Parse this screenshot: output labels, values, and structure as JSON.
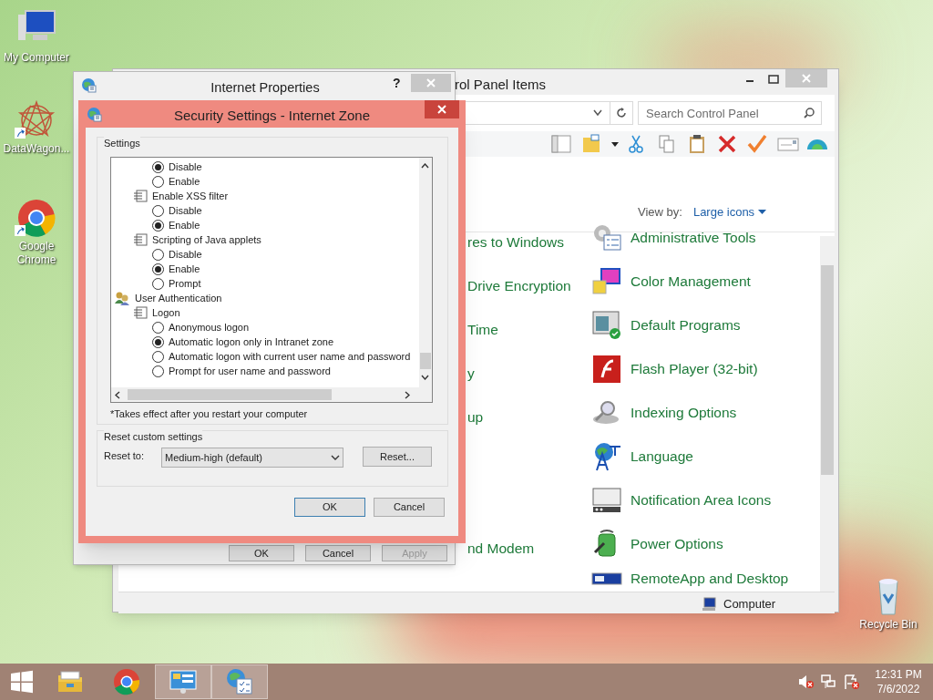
{
  "desktop_icons": [
    {
      "label": "My Computer"
    },
    {
      "label": "DataWagon..."
    },
    {
      "label": "Google Chrome"
    },
    {
      "label": "Recycle Bin"
    }
  ],
  "control_panel": {
    "title": "rol Panel Items",
    "search": {
      "placeholder": "Search Control Panel"
    },
    "view_by": {
      "label": "View by:",
      "value": "Large icons"
    },
    "left_items": [
      "res to Windows",
      "Drive Encryption",
      "Time",
      "y",
      "up",
      "nd Modem"
    ],
    "right_items": [
      "Administrative Tools",
      "Color Management",
      "Default Programs",
      "Flash Player (32-bit)",
      "Indexing Options",
      "Language",
      "Notification Area Icons",
      "Power Options",
      "RemoteApp and Desktop"
    ],
    "status_bar": "Computer"
  },
  "internet_properties": {
    "title": "Internet Properties",
    "help": "?",
    "buttons": [
      {
        "label": "OK",
        "disabled": false
      },
      {
        "label": "Cancel",
        "disabled": false
      },
      {
        "label": "Apply",
        "disabled": true
      }
    ]
  },
  "security_dialog": {
    "title": "Security Settings - Internet Zone",
    "settings_label": "Settings",
    "tree": [
      {
        "kind": "category",
        "children": [
          {
            "kind": "setting",
            "children": [
              {
                "kind": "radio",
                "label": "Disable",
                "selected": true
              },
              {
                "kind": "radio",
                "label": "Enable",
                "selected": false
              }
            ]
          },
          {
            "kind": "setting",
            "label": "Enable XSS filter",
            "children": [
              {
                "kind": "radio",
                "label": "Disable",
                "selected": false
              },
              {
                "kind": "radio",
                "label": "Enable",
                "selected": true
              }
            ]
          },
          {
            "kind": "setting",
            "label": "Scripting of Java applets",
            "children": [
              {
                "kind": "radio",
                "label": "Disable",
                "selected": false
              },
              {
                "kind": "radio",
                "label": "Enable",
                "selected": true
              },
              {
                "kind": "radio",
                "label": "Prompt",
                "selected": false
              }
            ]
          }
        ]
      },
      {
        "kind": "category",
        "label": "User Authentication",
        "children": [
          {
            "kind": "setting",
            "label": "Logon",
            "children": [
              {
                "kind": "radio",
                "label": "Anonymous logon",
                "selected": false
              },
              {
                "kind": "radio",
                "label": "Automatic logon only in Intranet zone",
                "selected": true
              },
              {
                "kind": "radio",
                "label": "Automatic logon with current user name and password",
                "selected": false
              },
              {
                "kind": "radio",
                "label": "Prompt for user name and password",
                "selected": false
              }
            ]
          }
        ]
      }
    ],
    "footnote": "*Takes effect after you restart your computer",
    "reset_group": "Reset custom settings",
    "reset_to_label": "Reset to:",
    "reset_to_value": "Medium-high (default)",
    "reset_button": "Reset...",
    "buttons": [
      "OK",
      "Cancel"
    ]
  },
  "taskbar": {
    "apps": [
      {
        "active": false
      },
      {
        "active": false
      },
      {
        "active": true
      },
      {
        "active": true
      }
    ],
    "time": "12:31 PM",
    "date": "7/6/2022"
  }
}
